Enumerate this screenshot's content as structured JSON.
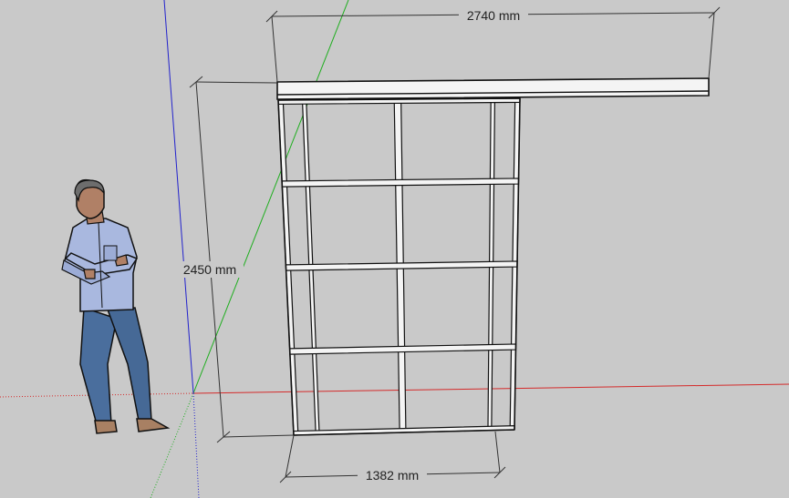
{
  "app": {
    "name": "3D modeling viewport"
  },
  "colors": {
    "background": "#c9c9c9",
    "axis_red": "#d42a2a",
    "axis_green": "#1fae1f",
    "axis_blue": "#2222cc",
    "frame_fill": "#f4f4f4",
    "frame_stroke": "#111111",
    "dimension_text": "#222222"
  },
  "dimensions": {
    "rail_width": "2740 mm",
    "door_height": "2450 mm",
    "door_width": "1382 mm"
  },
  "scene_objects": {
    "figure_icon": "standing-person-figure",
    "rail_icon": "top-track-rail",
    "door_icon": "sliding-door-frame"
  },
  "door": {
    "columns": 2,
    "rows": 4
  }
}
